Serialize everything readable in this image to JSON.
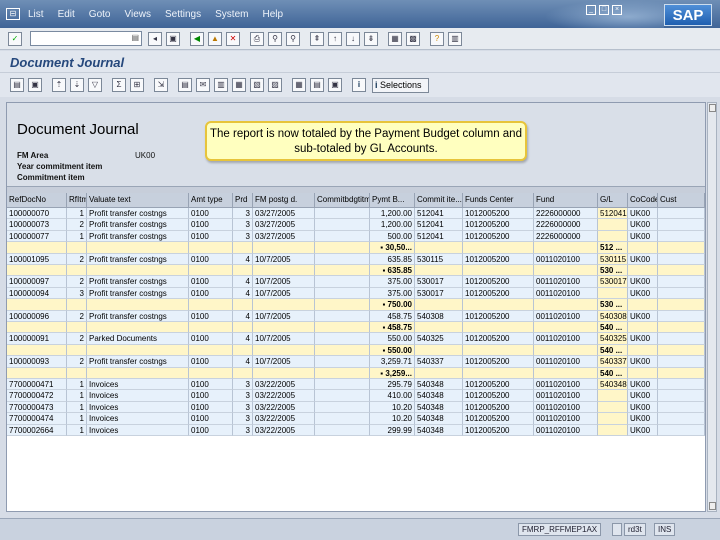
{
  "menu": {
    "items": [
      "List",
      "Edit",
      "Goto",
      "Views",
      "Settings",
      "System",
      "Help"
    ]
  },
  "command_field": {
    "value": ""
  },
  "page_title": "Document Journal",
  "toolbar2": {
    "selections_label": "Selections"
  },
  "report": {
    "title": "Document Journal",
    "labels": [
      "FM Area",
      "Year commitment item",
      "Commitment item"
    ],
    "fm_area_value": "UK00"
  },
  "callout": {
    "text": "The report is now totaled by the Payment Budget column and sub-totaled by GL Accounts."
  },
  "table": {
    "columns": [
      "RefDocNo",
      "RfItm",
      "Valuate text",
      "Amt type",
      "Prd",
      "FM postg d.",
      "Commitbdgtitm",
      "Pymt B...",
      "Commit ite...",
      "Funds Center",
      "Fund",
      "G/L",
      "CoCode",
      "Cust"
    ],
    "rows": [
      {
        "type": "data",
        "cells": [
          "100000070",
          "1",
          "Profit transfer costngs",
          "0100",
          "3",
          "03/27/2005",
          "",
          "1,200.00",
          "512041",
          "1012005200",
          "2226000000",
          "512041",
          "UK00",
          ""
        ]
      },
      {
        "type": "data",
        "cells": [
          "100000073",
          "2",
          "Profit transfer costngs",
          "0100",
          "3",
          "03/27/2005",
          "",
          "1,200.00",
          "512041",
          "1012005200",
          "2226000000",
          "",
          "UK00",
          ""
        ]
      },
      {
        "type": "data",
        "cells": [
          "100000077",
          "1",
          "Profit transfer costngs",
          "0100",
          "3",
          "03/27/2005",
          "",
          "500.00",
          "512041",
          "1012005200",
          "2226000000",
          "",
          "UK00",
          ""
        ]
      },
      {
        "type": "sub",
        "cells": [
          "",
          "",
          "",
          "",
          "",
          "",
          "",
          "30,50...",
          "",
          "",
          "",
          "512 ...",
          "",
          ""
        ]
      },
      {
        "type": "data",
        "cells": [
          "100001095",
          "2",
          "Profit transfer costngs",
          "0100",
          "4",
          "10/7/2005",
          "",
          "635.85",
          "530115",
          "1012005200",
          "0011020100",
          "530115",
          "UK00",
          ""
        ]
      },
      {
        "type": "sub",
        "cells": [
          "",
          "",
          "",
          "",
          "",
          "",
          "",
          "635.85",
          "",
          "",
          "",
          "530 ...",
          "",
          ""
        ]
      },
      {
        "type": "data",
        "cells": [
          "100000097",
          "2",
          "Profit transfer costngs",
          "0100",
          "4",
          "10/7/2005",
          "",
          "375.00",
          "530017",
          "1012005200",
          "0011020100",
          "530017",
          "UK00",
          ""
        ]
      },
      {
        "type": "data",
        "cells": [
          "100000094",
          "3",
          "Profit transfer costngs",
          "0100",
          "4",
          "10/7/2005",
          "",
          "375.00",
          "530017",
          "1012005200",
          "0011020100",
          "",
          "UK00",
          ""
        ]
      },
      {
        "type": "sub",
        "cells": [
          "",
          "",
          "",
          "",
          "",
          "",
          "",
          "750.00",
          "",
          "",
          "",
          "530 ...",
          "",
          ""
        ]
      },
      {
        "type": "data",
        "cells": [
          "100000096",
          "2",
          "Profit transfer costngs",
          "0100",
          "4",
          "10/7/2005",
          "",
          "458.75",
          "540308",
          "1012005200",
          "0011020100",
          "540308",
          "UK00",
          ""
        ]
      },
      {
        "type": "sub",
        "cells": [
          "",
          "",
          "",
          "",
          "",
          "",
          "",
          "458.75",
          "",
          "",
          "",
          "540 ...",
          "",
          ""
        ]
      },
      {
        "type": "data",
        "cells": [
          "100000091",
          "2",
          "Parked Documents",
          "0100",
          "4",
          "10/7/2005",
          "",
          "550.00",
          "540325",
          "1012005200",
          "0011020100",
          "540325",
          "UK00",
          ""
        ]
      },
      {
        "type": "sub",
        "cells": [
          "",
          "",
          "",
          "",
          "",
          "",
          "",
          "550.00",
          "",
          "",
          "",
          "540 ...",
          "",
          ""
        ]
      },
      {
        "type": "data",
        "cells": [
          "100000093",
          "2",
          "Profit transfer costngs",
          "0100",
          "4",
          "10/7/2005",
          "",
          "3,259.71",
          "540337",
          "1012005200",
          "0011020100",
          "540337",
          "UK00",
          ""
        ]
      },
      {
        "type": "sub",
        "cells": [
          "",
          "",
          "",
          "",
          "",
          "",
          "",
          "3,259...",
          "",
          "",
          "",
          "540 ...",
          "",
          ""
        ]
      },
      {
        "type": "data",
        "cells": [
          "7700000471",
          "1",
          "Invoices",
          "0100",
          "3",
          "03/22/2005",
          "",
          "295.79",
          "540348",
          "1012005200",
          "0011020100",
          "540348",
          "UK00",
          ""
        ]
      },
      {
        "type": "data",
        "cells": [
          "7700000472",
          "1",
          "Invoices",
          "0100",
          "3",
          "03/22/2005",
          "",
          "410.00",
          "540348",
          "1012005200",
          "0011020100",
          "",
          "UK00",
          ""
        ]
      },
      {
        "type": "data",
        "cells": [
          "7700000473",
          "1",
          "Invoices",
          "0100",
          "3",
          "03/22/2005",
          "",
          "10.20",
          "540348",
          "1012005200",
          "0011020100",
          "",
          "UK00",
          ""
        ]
      },
      {
        "type": "data",
        "cells": [
          "7700000474",
          "1",
          "Invoices",
          "0100",
          "3",
          "03/22/2005",
          "",
          "10.20",
          "540348",
          "1012005200",
          "0011020100",
          "",
          "UK00",
          ""
        ]
      },
      {
        "type": "data",
        "cells": [
          "7700002664",
          "1",
          "Invoices",
          "0100",
          "3",
          "03/22/2005",
          "",
          "299.99",
          "540348",
          "1012005200",
          "0011020100",
          "",
          "UK00",
          ""
        ]
      }
    ]
  },
  "status": {
    "system": "FMRP_RFFMEP1AX",
    "server": "rd3t",
    "mode": "INS"
  },
  "colors": {
    "menubar": "#4a6fa3",
    "subtotal": "#fff6c8",
    "data_row": "#e7f1fb",
    "callout": "#ffffbf",
    "title": "#26487c"
  },
  "icons": [
    "enter-icon",
    "save-icon",
    "back-icon",
    "exit-icon",
    "cancel-icon",
    "print-icon",
    "find-icon",
    "find-next-icon",
    "first-page-icon",
    "previous-page-icon",
    "next-page-icon",
    "last-page-icon",
    "create-session-icon",
    "shortcut-icon",
    "help-icon",
    "layout-icon"
  ]
}
